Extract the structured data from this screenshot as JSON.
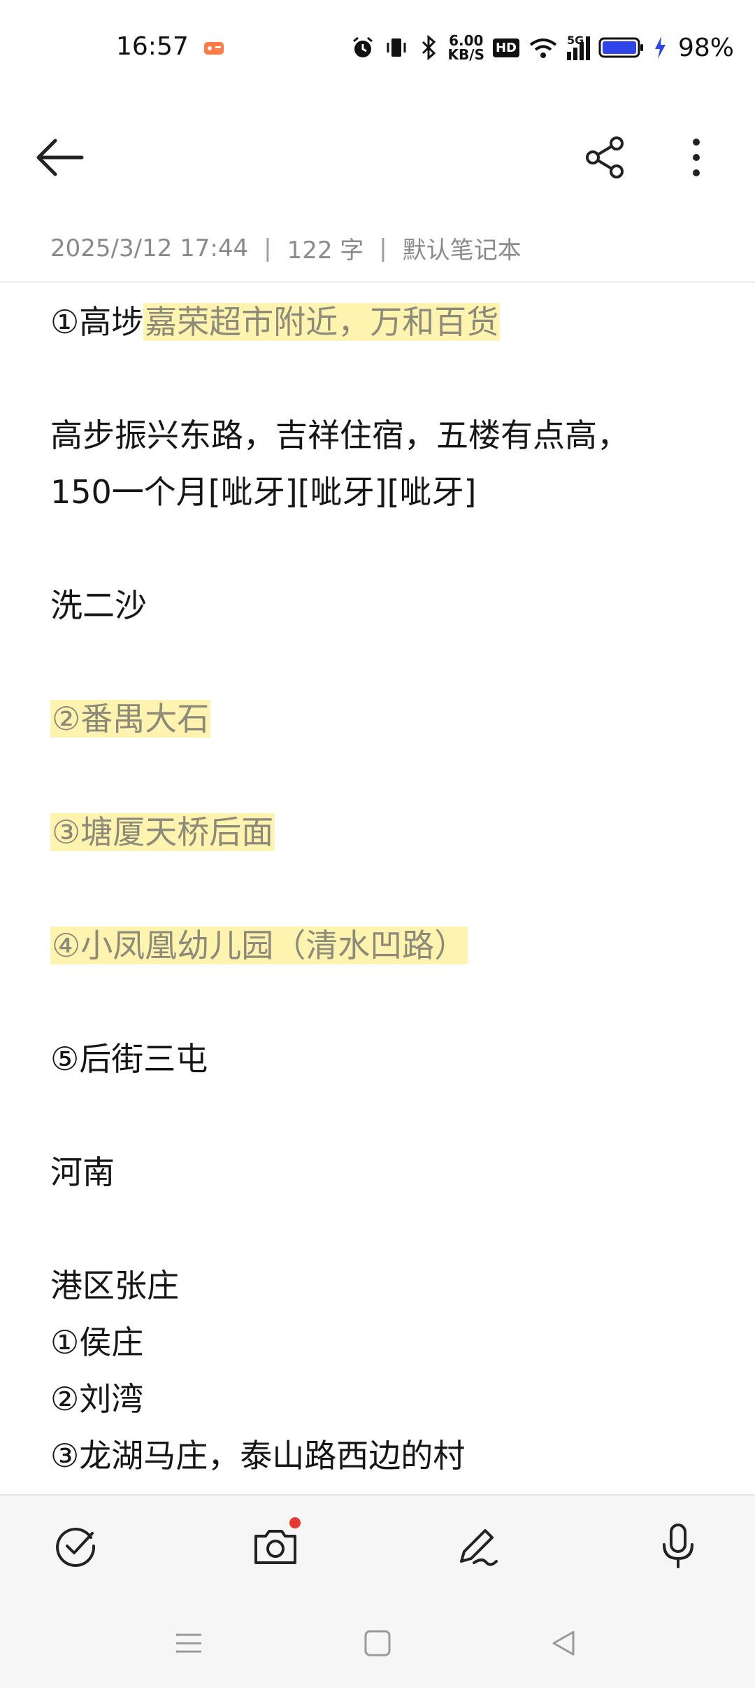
{
  "status_bar": {
    "time": "16:57",
    "speed_value": "6.00",
    "speed_unit": "KB/S",
    "hd": "HD",
    "network": "5G",
    "battery": "98%",
    "icons": [
      "app-notification-icon",
      "alarm-icon",
      "vibrate-icon",
      "bluetooth-icon",
      "wifi-icon",
      "signal-icon",
      "battery-icon",
      "charging-icon"
    ]
  },
  "toolbar": {
    "icons": [
      "back-arrow-icon",
      "share-icon",
      "more-vertical-icon"
    ]
  },
  "meta": {
    "datetime": "2025/3/12 17:44",
    "sep1": "|",
    "word_count": "122 字",
    "sep2": "|",
    "notebook": "默认笔记本"
  },
  "note": {
    "l1_prefix": "①高埗",
    "l1_highlight": "嘉荣超市附近，万和百货",
    "l2": "高步振兴东路，吉祥住宿，五楼有点高，",
    "l3": "150一个月[呲牙][呲牙][呲牙]",
    "l4": "洗二沙",
    "l5": "②番禺大石",
    "l6": "③塘厦天桥后面",
    "l7": "④小凤凰幼儿园（清水凹路）",
    "l8": "⑤后街三屯",
    "l9": "河南",
    "l10": "港区张庄",
    "l11": "①侯庄",
    "l12": "②刘湾",
    "l13": "③龙湖马庄，泰山路西边的村"
  },
  "bottom_bar": {
    "icons": [
      "checklist-icon",
      "camera-icon",
      "handwriting-pen-icon",
      "microphone-icon"
    ]
  },
  "nav_bar": {
    "icons": [
      "menu-icon",
      "home-icon",
      "back-icon"
    ]
  },
  "colors": {
    "highlight_bg": "#fff3b0",
    "highlight_text": "#8c8a78",
    "notification_dot": "#e53935",
    "battery_fill": "#2f45e8"
  }
}
